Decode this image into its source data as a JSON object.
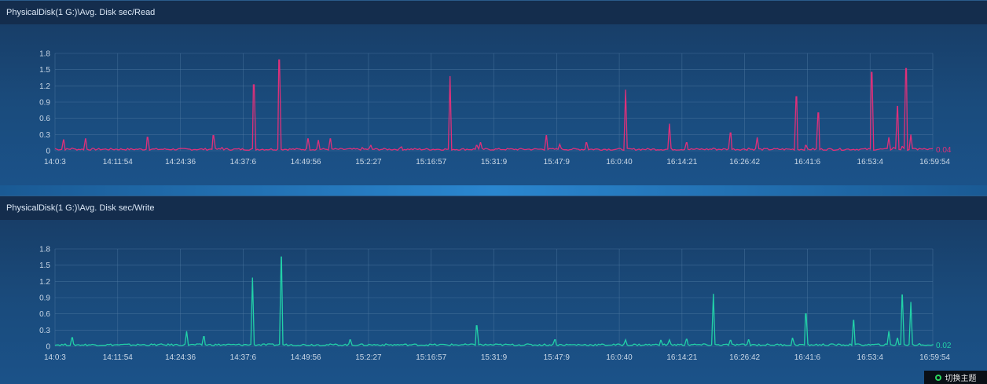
{
  "theme_button": {
    "label": "切换主题",
    "icon": "refresh-circle-icon",
    "icon_color": "#2bd75e"
  },
  "chart_data": [
    {
      "type": "line",
      "title": "PhysicalDisk(1 G:)\\Avg. Disk sec/Read",
      "color": "#e0307a",
      "ylim": [
        0,
        1.8
      ],
      "y_ticks": [
        "0",
        "0.3",
        "0.6",
        "0.9",
        "1.2",
        "1.5",
        "1.8"
      ],
      "x_ticks": [
        "14:0:3",
        "14:11:54",
        "14:24:36",
        "14:37:6",
        "14:49:56",
        "15:2:27",
        "15:16:57",
        "15:31:9",
        "15:47:9",
        "16:0:40",
        "16:14:21",
        "16:26:42",
        "16:41:6",
        "16:53:4",
        "16:59:54"
      ],
      "last_value": "0.04",
      "grid": true,
      "x": [
        0,
        0.01,
        0.02,
        0.035,
        0.07,
        0.105,
        0.18,
        0.19,
        0.226,
        0.255,
        0.288,
        0.3,
        0.314,
        0.35,
        0.36,
        0.395,
        0.45,
        0.48,
        0.485,
        0.56,
        0.575,
        0.605,
        0.65,
        0.7,
        0.7,
        0.72,
        0.75,
        0.77,
        0.79,
        0.8,
        0.845,
        0.855,
        0.87,
        0.93,
        0.95,
        0.955,
        0.96,
        0.965,
        0.97,
        0.975,
        0.98,
        0.985,
        0.99,
        1.0
      ],
      "values": [
        0.04,
        0.2,
        0.05,
        0.22,
        0.03,
        0.25,
        0.28,
        0.06,
        1.22,
        1.68,
        0.22,
        0.2,
        0.22,
        0.06,
        0.1,
        0.07,
        1.38,
        0.1,
        0.15,
        0.28,
        0.12,
        0.15,
        1.13,
        0.5,
        0.5,
        0.15,
        0.05,
        0.33,
        0.05,
        0.25,
        1.0,
        0.1,
        0.7,
        1.45,
        0.25,
        0.06,
        0.82,
        0.08,
        1.52,
        0.3,
        0.04,
        0.04,
        0.04,
        0.04
      ]
    },
    {
      "type": "line",
      "title": "PhysicalDisk(1 G:)\\Avg. Disk sec/Write",
      "color": "#22d1a8",
      "ylim": [
        0,
        1.8
      ],
      "y_ticks": [
        "0",
        "0.3",
        "0.6",
        "0.9",
        "1.2",
        "1.5",
        "1.8"
      ],
      "x_ticks": [
        "14:0:3",
        "14:11:54",
        "14:24:36",
        "14:37:6",
        "14:49:56",
        "15:2:27",
        "15:16:57",
        "15:31:9",
        "15:47:9",
        "16:0:40",
        "16:14:21",
        "16:26:42",
        "16:41:6",
        "16:53:4",
        "16:59:54"
      ],
      "last_value": "0.02",
      "grid": true,
      "x": [
        0,
        0.02,
        0.15,
        0.17,
        0.225,
        0.258,
        0.336,
        0.48,
        0.57,
        0.65,
        0.69,
        0.7,
        0.72,
        0.75,
        0.77,
        0.79,
        0.84,
        0.855,
        0.91,
        0.95,
        0.96,
        0.965,
        0.975,
        0.985,
        0.99,
        1.0
      ],
      "values": [
        0.02,
        0.16,
        0.28,
        0.18,
        1.27,
        1.65,
        0.12,
        0.38,
        0.12,
        0.12,
        0.11,
        0.12,
        0.13,
        0.97,
        0.11,
        0.12,
        0.15,
        0.6,
        0.48,
        0.28,
        0.15,
        0.95,
        0.82,
        0.05,
        0.02,
        0.02
      ]
    }
  ]
}
